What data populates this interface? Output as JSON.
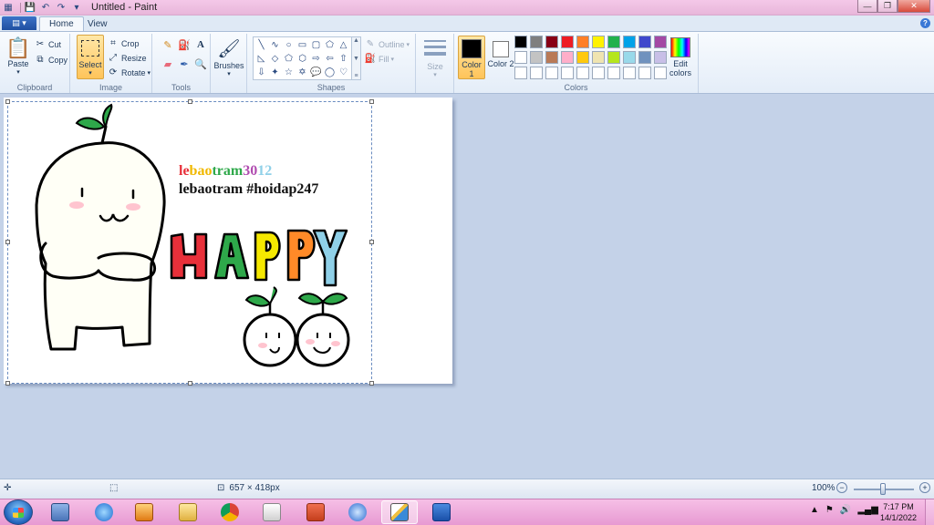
{
  "window": {
    "title": "Untitled - Paint"
  },
  "tabs": {
    "file_label": "",
    "home": "Home",
    "view": "View"
  },
  "clipboard": {
    "paste": "Paste",
    "cut": "Cut",
    "copy": "Copy",
    "label": "Clipboard"
  },
  "image": {
    "select": "Select",
    "crop": "Crop",
    "resize": "Resize",
    "rotate": "Rotate",
    "label": "Image"
  },
  "tools": {
    "label": "Tools"
  },
  "brushes": {
    "label": "Brushes"
  },
  "shapes": {
    "outline": "Outline",
    "fill": "Fill",
    "label": "Shapes"
  },
  "size": {
    "label": "Size"
  },
  "colors": {
    "color1": "Color 1",
    "color2": "Color 2",
    "edit": "Edit colors",
    "label": "Colors",
    "color1_value": "#000000",
    "color2_value": "#ffffff",
    "palette": [
      "#000000",
      "#7f7f7f",
      "#880015",
      "#ed1c24",
      "#ff7f27",
      "#fff200",
      "#22b14c",
      "#00a2e8",
      "#3f48cc",
      "#a349a4",
      "#ffffff",
      "#c3c3c3",
      "#b97a57",
      "#ffaec9",
      "#ffc90e",
      "#efe4b0",
      "#b5e61d",
      "#99d9ea",
      "#7092be",
      "#c8bfe7",
      "#ffffff",
      "#ffffff",
      "#ffffff",
      "#ffffff",
      "#ffffff",
      "#ffffff",
      "#ffffff",
      "#ffffff",
      "#ffffff",
      "#ffffff"
    ]
  },
  "canvas": {
    "line1_parts": [
      {
        "t": "le",
        "c": "#e8303a"
      },
      {
        "t": "bao",
        "c": "#f0b800"
      },
      {
        "t": "tram",
        "c": "#2ea84a"
      },
      {
        "t": "30",
        "c": "#b04cb0"
      },
      {
        "t": "12",
        "c": "#8fd0e8"
      }
    ],
    "line2": "lebaotram #hoidap247",
    "happy_letters": [
      {
        "t": "H",
        "c": "#e8303a"
      },
      {
        "t": "A",
        "c": "#2ea84a"
      },
      {
        "t": "P",
        "c": "#f5e800"
      },
      {
        "t": "P",
        "c": "#ff8a28"
      },
      {
        "t": "Y",
        "c": "#8fd0e8"
      }
    ]
  },
  "status": {
    "dimensions": "657 × 418px",
    "zoom": "100%"
  },
  "taskbar": {
    "time": "7:17 PM",
    "date": "14/1/2022"
  }
}
